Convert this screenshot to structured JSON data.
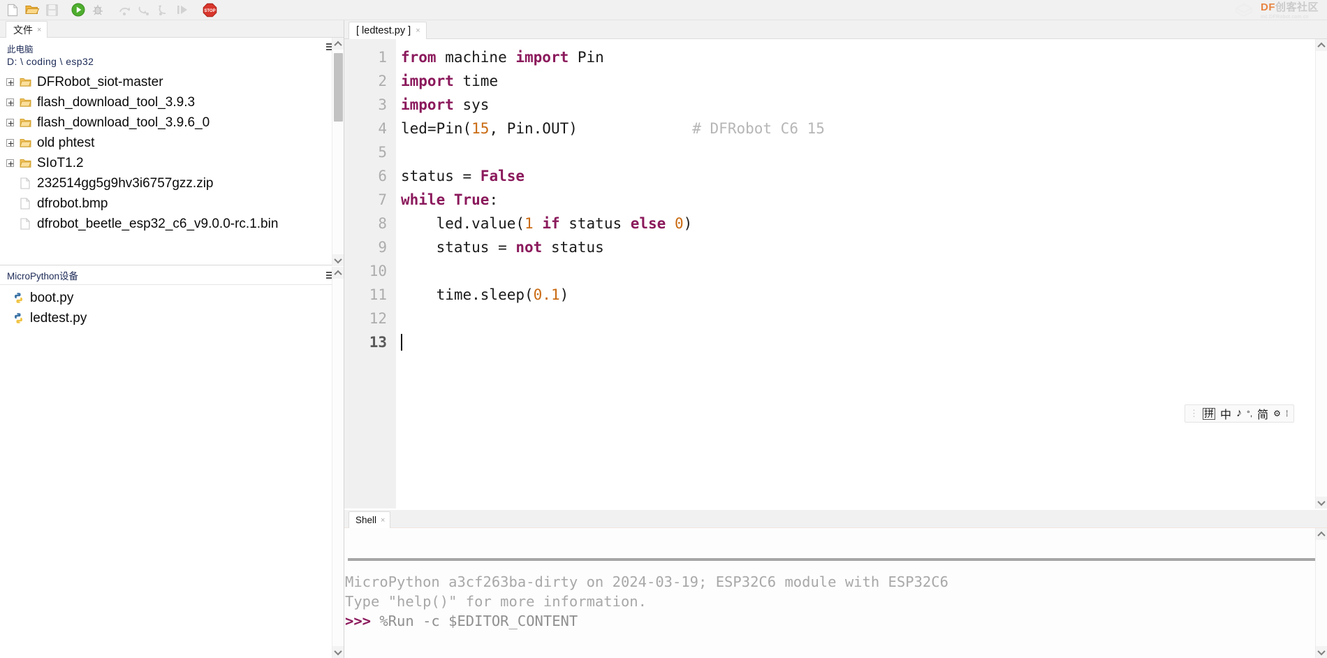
{
  "toolbar": {
    "buttons": [
      {
        "name": "new-file-icon",
        "label": "新建"
      },
      {
        "name": "open-folder-icon",
        "label": "打开"
      },
      {
        "name": "save-icon",
        "label": "保存"
      },
      {
        "name": "run-icon",
        "label": "运行"
      },
      {
        "name": "debug-icon",
        "label": "调试"
      },
      {
        "name": "step-over-icon",
        "label": "跳过"
      },
      {
        "name": "step-into-icon",
        "label": "步入"
      },
      {
        "name": "step-out-icon",
        "label": "步出"
      },
      {
        "name": "resume-icon",
        "label": "继续"
      },
      {
        "name": "stop-icon",
        "label": "STOP"
      }
    ]
  },
  "brand": {
    "main_prefix": "DF",
    "main_suffix": "创客社区",
    "sub": "mc.DFRobot.com.cn"
  },
  "left_pane": {
    "tab_label": "文件",
    "tab_close": "×",
    "menu_icon": "hamburger-icon",
    "root_label": "此电脑",
    "root_path": "D: \\ coding \\ esp32",
    "tree": [
      {
        "name": "DFRobot_siot-master",
        "type": "folder",
        "expandable": true
      },
      {
        "name": "flash_download_tool_3.9.3",
        "type": "folder",
        "expandable": true
      },
      {
        "name": "flash_download_tool_3.9.6_0",
        "type": "folder",
        "expandable": true
      },
      {
        "name": "old phtest",
        "type": "folder",
        "expandable": true
      },
      {
        "name": "SIoT1.2",
        "type": "folder",
        "expandable": true
      },
      {
        "name": "232514gg5g9hv3i6757gzz.zip",
        "type": "file",
        "expandable": false
      },
      {
        "name": "dfrobot.bmp",
        "type": "file",
        "expandable": false
      },
      {
        "name": "dfrobot_beetle_esp32_c6_v9.0.0-rc.1.bin",
        "type": "file",
        "expandable": false
      }
    ],
    "device_section": {
      "title": "MicroPython设备",
      "menu_icon": "hamburger-icon",
      "files": [
        {
          "name": "boot.py",
          "type": "python"
        },
        {
          "name": "ledtest.py",
          "type": "python"
        }
      ]
    }
  },
  "editor": {
    "tab_label": "[ ledtest.py ]",
    "tab_close": "×",
    "cursor_line": 13,
    "lines": [
      {
        "n": "1",
        "tokens": [
          {
            "t": "from ",
            "c": "kw"
          },
          {
            "t": "machine ",
            "c": ""
          },
          {
            "t": "import ",
            "c": "kw"
          },
          {
            "t": "Pin",
            "c": ""
          }
        ]
      },
      {
        "n": "2",
        "tokens": [
          {
            "t": "import ",
            "c": "kw"
          },
          {
            "t": "time",
            "c": ""
          }
        ]
      },
      {
        "n": "3",
        "tokens": [
          {
            "t": "import ",
            "c": "kw"
          },
          {
            "t": "sys",
            "c": ""
          }
        ]
      },
      {
        "n": "4",
        "tokens": [
          {
            "t": "led=Pin(",
            "c": ""
          },
          {
            "t": "15",
            "c": "num"
          },
          {
            "t": ", Pin.OUT)",
            "c": ""
          },
          {
            "t": "             # DFRobot C6 15",
            "c": "cmt"
          }
        ]
      },
      {
        "n": "5",
        "tokens": []
      },
      {
        "n": "6",
        "tokens": [
          {
            "t": "status = ",
            "c": ""
          },
          {
            "t": "False",
            "c": "kw"
          }
        ]
      },
      {
        "n": "7",
        "tokens": [
          {
            "t": "while ",
            "c": "kw"
          },
          {
            "t": "True",
            "c": "kw"
          },
          {
            "t": ":",
            "c": ""
          }
        ]
      },
      {
        "n": "8",
        "tokens": [
          {
            "t": "    led.value(",
            "c": ""
          },
          {
            "t": "1",
            "c": "num"
          },
          {
            "t": " if ",
            "c": "kw"
          },
          {
            "t": "status",
            "c": ""
          },
          {
            "t": " else ",
            "c": "kw"
          },
          {
            "t": "0",
            "c": "num"
          },
          {
            "t": ")",
            "c": ""
          }
        ]
      },
      {
        "n": "9",
        "tokens": [
          {
            "t": "    status = ",
            "c": ""
          },
          {
            "t": "not",
            "c": "kw"
          },
          {
            "t": " status",
            "c": ""
          }
        ]
      },
      {
        "n": "10",
        "tokens": []
      },
      {
        "n": "11",
        "tokens": [
          {
            "t": "    time.sleep(",
            "c": ""
          },
          {
            "t": "0.1",
            "c": "num"
          },
          {
            "t": ")",
            "c": ""
          }
        ]
      },
      {
        "n": "12",
        "tokens": []
      },
      {
        "n": "13",
        "tokens": []
      }
    ],
    "ime": {
      "mode": "拼",
      "lang": "中",
      "music": "♪",
      "punct": "°,",
      "simplified": "简",
      "settings": "⚙",
      "more": "⁞"
    }
  },
  "shell": {
    "tab_label": "Shell",
    "tab_close": "×",
    "input_value": "",
    "output": [
      {
        "type": "plain",
        "text": "MicroPython a3cf263ba-dirty on 2024-03-19; ESP32C6 module with ESP32C6"
      },
      {
        "type": "plain",
        "text": "Type \"help()\" for more information."
      },
      {
        "type": "prompt",
        "prompt": ">>>",
        "text": " %Run -c $EDITOR_CONTENT"
      }
    ]
  },
  "colors": {
    "keyword": "#8b1a5c",
    "number": "#c96a12",
    "comment": "#b6b6b6",
    "gutter_bg": "#f0f0f0",
    "brand_orange": "#e8803a"
  }
}
